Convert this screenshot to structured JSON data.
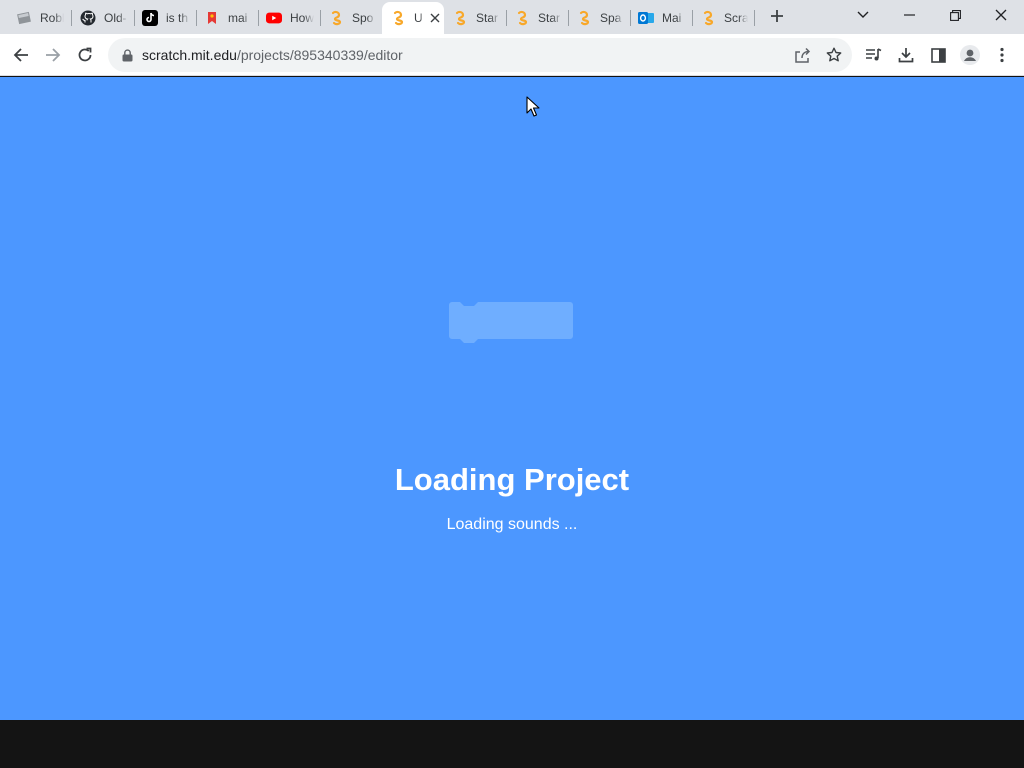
{
  "tabs": [
    {
      "title": "Robl",
      "icon": "roblox-icon"
    },
    {
      "title": "Old-",
      "icon": "github-icon"
    },
    {
      "title": "is th",
      "icon": "tiktok-icon"
    },
    {
      "title": "mai",
      "icon": "red-bookmark-icon"
    },
    {
      "title": "How",
      "icon": "youtube-icon"
    },
    {
      "title": "Spo",
      "icon": "scratch-icon"
    },
    {
      "title": "U",
      "icon": "scratch-icon",
      "active": true
    },
    {
      "title": "Star",
      "icon": "scratch-icon"
    },
    {
      "title": "Star",
      "icon": "scratch-icon"
    },
    {
      "title": "Spa",
      "icon": "scratch-icon"
    },
    {
      "title": "Mai",
      "icon": "outlook-icon"
    },
    {
      "title": "Scra",
      "icon": "scratch-icon"
    }
  ],
  "address_bar": {
    "domain": "scratch.mit.edu",
    "path": "/projects/895340339/editor"
  },
  "loading": {
    "title": "Loading Project",
    "status": "Loading sounds ..."
  },
  "colors": {
    "background": "#4c97ff",
    "block": "#6faeff",
    "tabstrip": "#dee1e6",
    "bottom_bar": "#141414"
  }
}
